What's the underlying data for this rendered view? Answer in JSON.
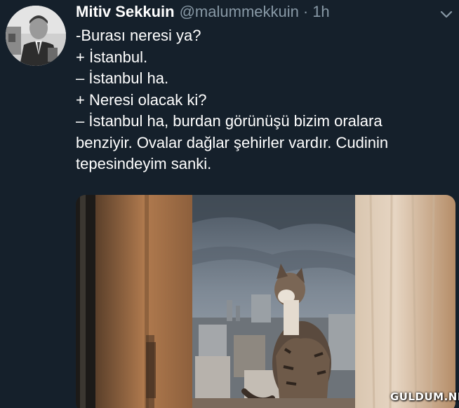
{
  "tweet": {
    "display_name": "Mitiv Sekkuin",
    "handle": "@malummekkuin",
    "separator": "·",
    "time": "1h",
    "lines": [
      "-Burası neresi ya?",
      "+ İstanbul.",
      "– İstanbul ha.",
      "+ Neresi olacak ki?",
      "– İstanbul ha, burdan görünüşü bizim oralara",
      "benziyir. Ovalar dağlar şehirler vardır. Cudinin",
      "tepesindeyim sanki."
    ]
  },
  "media": {
    "watermark": "GULDUM.NET"
  },
  "icons": {
    "menu": "chevron-down-icon"
  },
  "colors": {
    "background": "#15202b",
    "text": "#ffffff",
    "secondary": "#8899a6"
  }
}
